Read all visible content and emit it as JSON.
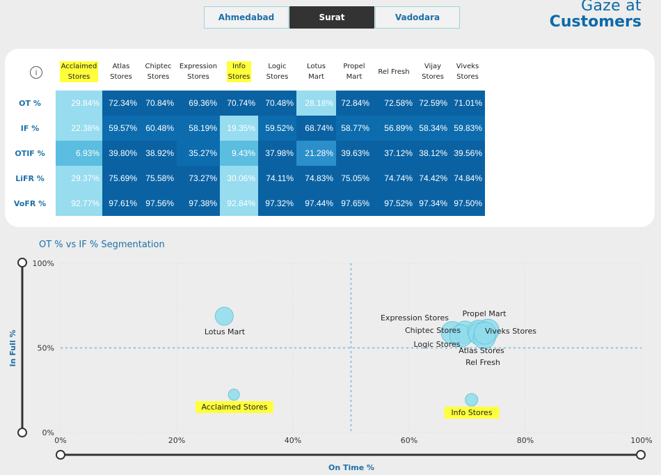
{
  "tabs": [
    {
      "label": "Ahmedabad",
      "active": false
    },
    {
      "label": "Surat",
      "active": true
    },
    {
      "label": "Vadodara",
      "active": false
    }
  ],
  "brand": {
    "line1": "Gaze at",
    "line2": "Customers"
  },
  "matrix": {
    "info_icon": "info-icon",
    "columns": [
      {
        "line1": "Acclaimed",
        "line2": "Stores",
        "highlight": true
      },
      {
        "line1": "Atlas",
        "line2": "Stores",
        "highlight": false
      },
      {
        "line1": "Chiptec",
        "line2": "Stores",
        "highlight": false
      },
      {
        "line1": "Expression",
        "line2": "Stores",
        "highlight": false
      },
      {
        "line1": "Info",
        "line2": "Stores",
        "highlight": true
      },
      {
        "line1": "Logic",
        "line2": "Stores",
        "highlight": false
      },
      {
        "line1": "Lotus",
        "line2": "Mart",
        "highlight": false
      },
      {
        "line1": "Propel",
        "line2": "Mart",
        "highlight": false
      },
      {
        "line1": "Rel Fresh",
        "line2": "",
        "highlight": false
      },
      {
        "line1": "Vijay",
        "line2": "Stores",
        "highlight": false
      },
      {
        "line1": "Viveks",
        "line2": "Stores",
        "highlight": false
      }
    ],
    "rows": [
      {
        "label": "OT %",
        "values": [
          "29.84%",
          "72.34%",
          "70.84%",
          "69.36%",
          "70.74%",
          "70.48%",
          "28.18%",
          "72.84%",
          "72.58%",
          "72.59%",
          "71.01%"
        ]
      },
      {
        "label": "IF %",
        "values": [
          "22.38%",
          "59.57%",
          "60.48%",
          "58.19%",
          "19.35%",
          "59.52%",
          "68.74%",
          "58.77%",
          "56.89%",
          "58.34%",
          "59.83%"
        ]
      },
      {
        "label": "OTIF %",
        "values": [
          "6.93%",
          "39.80%",
          "38.92%",
          "35.27%",
          "9.43%",
          "37.98%",
          "21.28%",
          "39.63%",
          "37.12%",
          "38.12%",
          "39.56%"
        ]
      },
      {
        "label": "LiFR %",
        "values": [
          "29.37%",
          "75.69%",
          "75.58%",
          "73.27%",
          "30.06%",
          "74.11%",
          "74.83%",
          "75.05%",
          "74.74%",
          "74.42%",
          "74.84%"
        ]
      },
      {
        "label": "VoFR %",
        "values": [
          "92.77%",
          "97.61%",
          "97.56%",
          "97.38%",
          "92.84%",
          "97.32%",
          "97.44%",
          "97.65%",
          "97.52%",
          "97.34%",
          "97.50%"
        ]
      }
    ]
  },
  "chart_data": {
    "type": "scatter",
    "title": "OT % vs IF % Segmentation",
    "xlabel": "On Time %",
    "ylabel": "In Full %",
    "xlim": [
      0,
      100
    ],
    "ylim": [
      0,
      100
    ],
    "x_ticks": [
      "0%",
      "20%",
      "40%",
      "60%",
      "80%",
      "100%"
    ],
    "y_ticks": [
      "0%",
      "50%",
      "100%"
    ],
    "reference_lines": {
      "x": 50,
      "y": 50
    },
    "grid": true,
    "point_color": "#8fdcec",
    "points": [
      {
        "name": "Lotus Mart",
        "x": 28.18,
        "y": 68.74,
        "label": "Lotus Mart",
        "highlight": false
      },
      {
        "name": "Acclaimed Stores",
        "x": 29.84,
        "y": 22.38,
        "label": "Acclaimed Stores",
        "highlight": true
      },
      {
        "name": "Info Stores",
        "x": 70.74,
        "y": 19.35,
        "label": "Info Stores",
        "highlight": true
      },
      {
        "name": "Expression Stores",
        "x": 69.36,
        "y": 58.19,
        "label": "Expression Stores",
        "highlight": false
      },
      {
        "name": "Chiptec Stores",
        "x": 70.84,
        "y": 60.48,
        "label": "Chiptec Stores",
        "highlight": false
      },
      {
        "name": "Logic Stores",
        "x": 70.48,
        "y": 59.52,
        "label": "Logic Stores",
        "highlight": false
      },
      {
        "name": "Propel Mart",
        "x": 72.84,
        "y": 58.77,
        "label": "Propel Mart",
        "highlight": false
      },
      {
        "name": "Viveks Stores",
        "x": 71.01,
        "y": 59.83,
        "label": "Viveks Stores",
        "highlight": false
      },
      {
        "name": "Atlas Stores",
        "x": 72.34,
        "y": 59.57,
        "label": "Atlas Stores",
        "highlight": false
      },
      {
        "name": "Rel Fresh",
        "x": 72.58,
        "y": 56.89,
        "label": "Rel Fresh",
        "highlight": false
      },
      {
        "name": "Vijay Stores",
        "x": 72.59,
        "y": 58.34,
        "label": "",
        "highlight": false
      }
    ]
  },
  "colors": {
    "heat_low": "#97dcef",
    "heat_mid": "#5bbde0",
    "heat_high": "#0b6fb0",
    "highlight": "#ffff3a",
    "accent": "#1d6fa8"
  }
}
